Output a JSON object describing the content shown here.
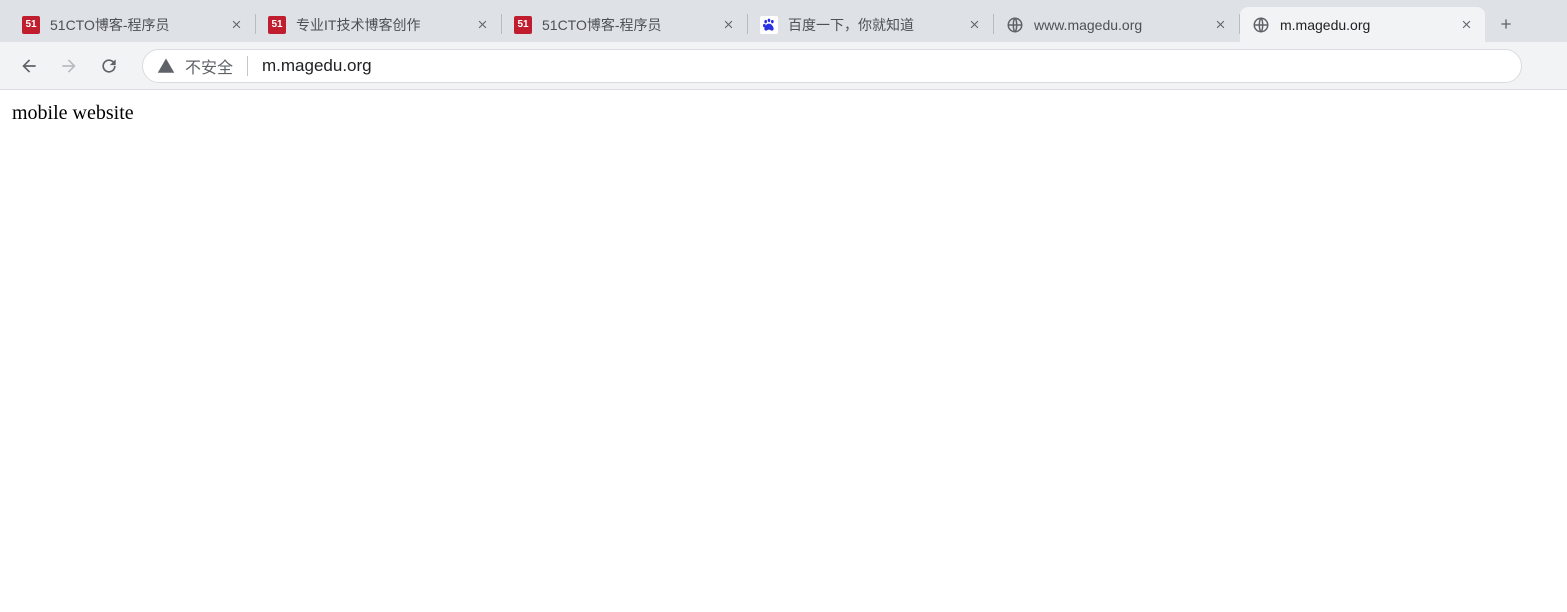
{
  "tabs": [
    {
      "title": "51CTO博客-程序员",
      "icon": "cto",
      "active": false
    },
    {
      "title": "专业IT技术博客创作",
      "icon": "cto",
      "active": false
    },
    {
      "title": "51CTO博客-程序员",
      "icon": "cto",
      "active": false
    },
    {
      "title": "百度一下，你就知道",
      "icon": "baidu",
      "active": false
    },
    {
      "title": "www.magedu.org",
      "icon": "globe",
      "active": false
    },
    {
      "title": "m.magedu.org",
      "icon": "globe",
      "active": true
    }
  ],
  "favicon_text": {
    "cto": "51"
  },
  "toolbar": {
    "security_label": "不安全",
    "url": "m.magedu.org"
  },
  "page": {
    "body_text": "mobile website"
  }
}
